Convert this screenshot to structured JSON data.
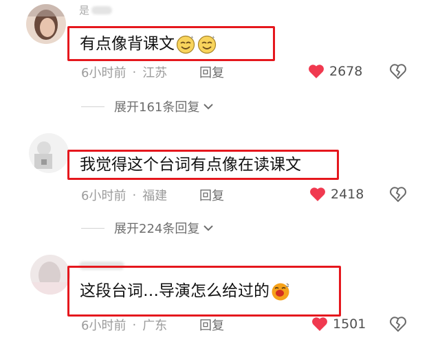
{
  "colors": {
    "highlight_border": "#e5171d",
    "heart": "#f0394f",
    "meta_text": "#9b9b9b"
  },
  "comments": [
    {
      "username_visible": "是",
      "text": "有点像背课文",
      "emojis": [
        "smirk-emoji",
        "smirk-emoji"
      ],
      "time": "6小时前",
      "location": "江苏",
      "reply_label": "回复",
      "likes": "2678",
      "expand_label": "展开161条回复"
    },
    {
      "text": "我觉得这个台词有点像在读课文",
      "time": "6小时前",
      "location": "福建",
      "reply_label": "回复",
      "likes": "2418",
      "expand_label": "展开224条回复"
    },
    {
      "text": "这段台词…导演怎么给过的",
      "emojis": [
        "yawn-emoji"
      ],
      "time": "6小时前",
      "location": "广东",
      "reply_label": "回复",
      "likes": "1501"
    }
  ],
  "separator": "·",
  "icons": {
    "like": "heart-icon",
    "dislike": "broken-heart-icon",
    "expand": "chevron-down-icon"
  }
}
